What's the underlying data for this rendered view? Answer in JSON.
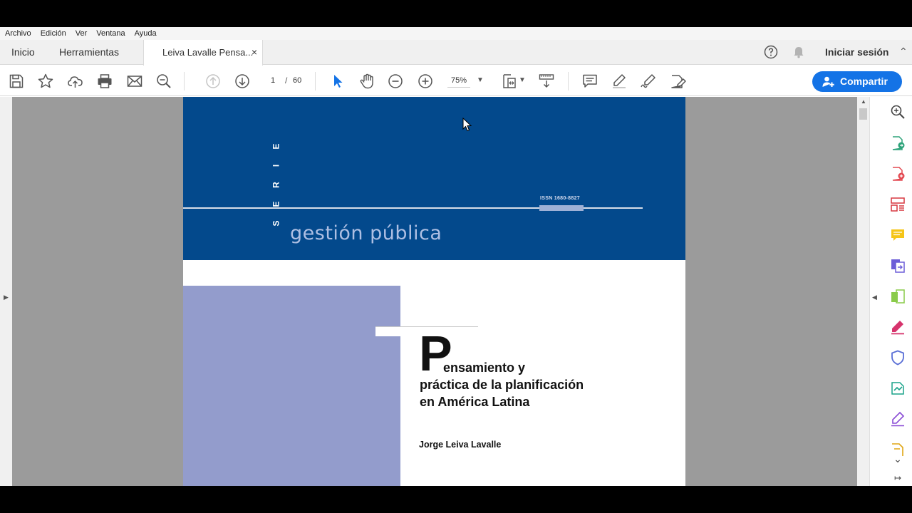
{
  "menu": [
    "Archivo",
    "Edición",
    "Ver",
    "Ventana",
    "Ayuda"
  ],
  "tabs": {
    "home": "Inicio",
    "tools": "Herramientas",
    "document": "Leiva Lavalle Pensa...",
    "close": "×"
  },
  "header": {
    "signin": "Iniciar sesión",
    "help_icon": "help-circle-icon",
    "bell_icon": "bell-icon"
  },
  "toolbar": {
    "page_current": "1",
    "page_separator": "/",
    "page_total": "60",
    "zoom": "75%",
    "share": "Compartir",
    "icons": [
      "save-icon",
      "star-icon",
      "cloud-upload-icon",
      "print-icon",
      "mail-icon",
      "zoom-search-icon",
      "page-up-icon",
      "page-down-icon",
      "select-cursor-icon",
      "hand-icon",
      "zoom-out-icon",
      "zoom-in-icon",
      "page-fit-icon",
      "scroll-mode-icon",
      "comment-icon",
      "highlight-pen-icon",
      "sign-icon",
      "edit-pdf-icon"
    ]
  },
  "right_panel_icons": [
    "search-icon",
    "export-pdf-icon",
    "create-pdf-icon",
    "organize-pages-icon",
    "comment-icon",
    "combine-files-icon",
    "compress-pdf-icon",
    "fill-sign-icon",
    "protect-icon",
    "send-for-review-icon",
    "request-signatures-icon",
    "more-tools-icon"
  ],
  "document": {
    "serie_letters": [
      "S",
      "E",
      "R",
      "I",
      "E"
    ],
    "issn": "ISSN 1680-8827",
    "collection": "gestión pública",
    "title_initial": "P",
    "title_line1": "ensamiento y",
    "title_line2": "práctica de la planificación",
    "title_line3": "en América Latina",
    "author": "Jorge Leiva Lavalle"
  },
  "colors": {
    "banner_blue": "#03498c",
    "purple_block": "#939ccc",
    "accent": "#1473e6"
  }
}
